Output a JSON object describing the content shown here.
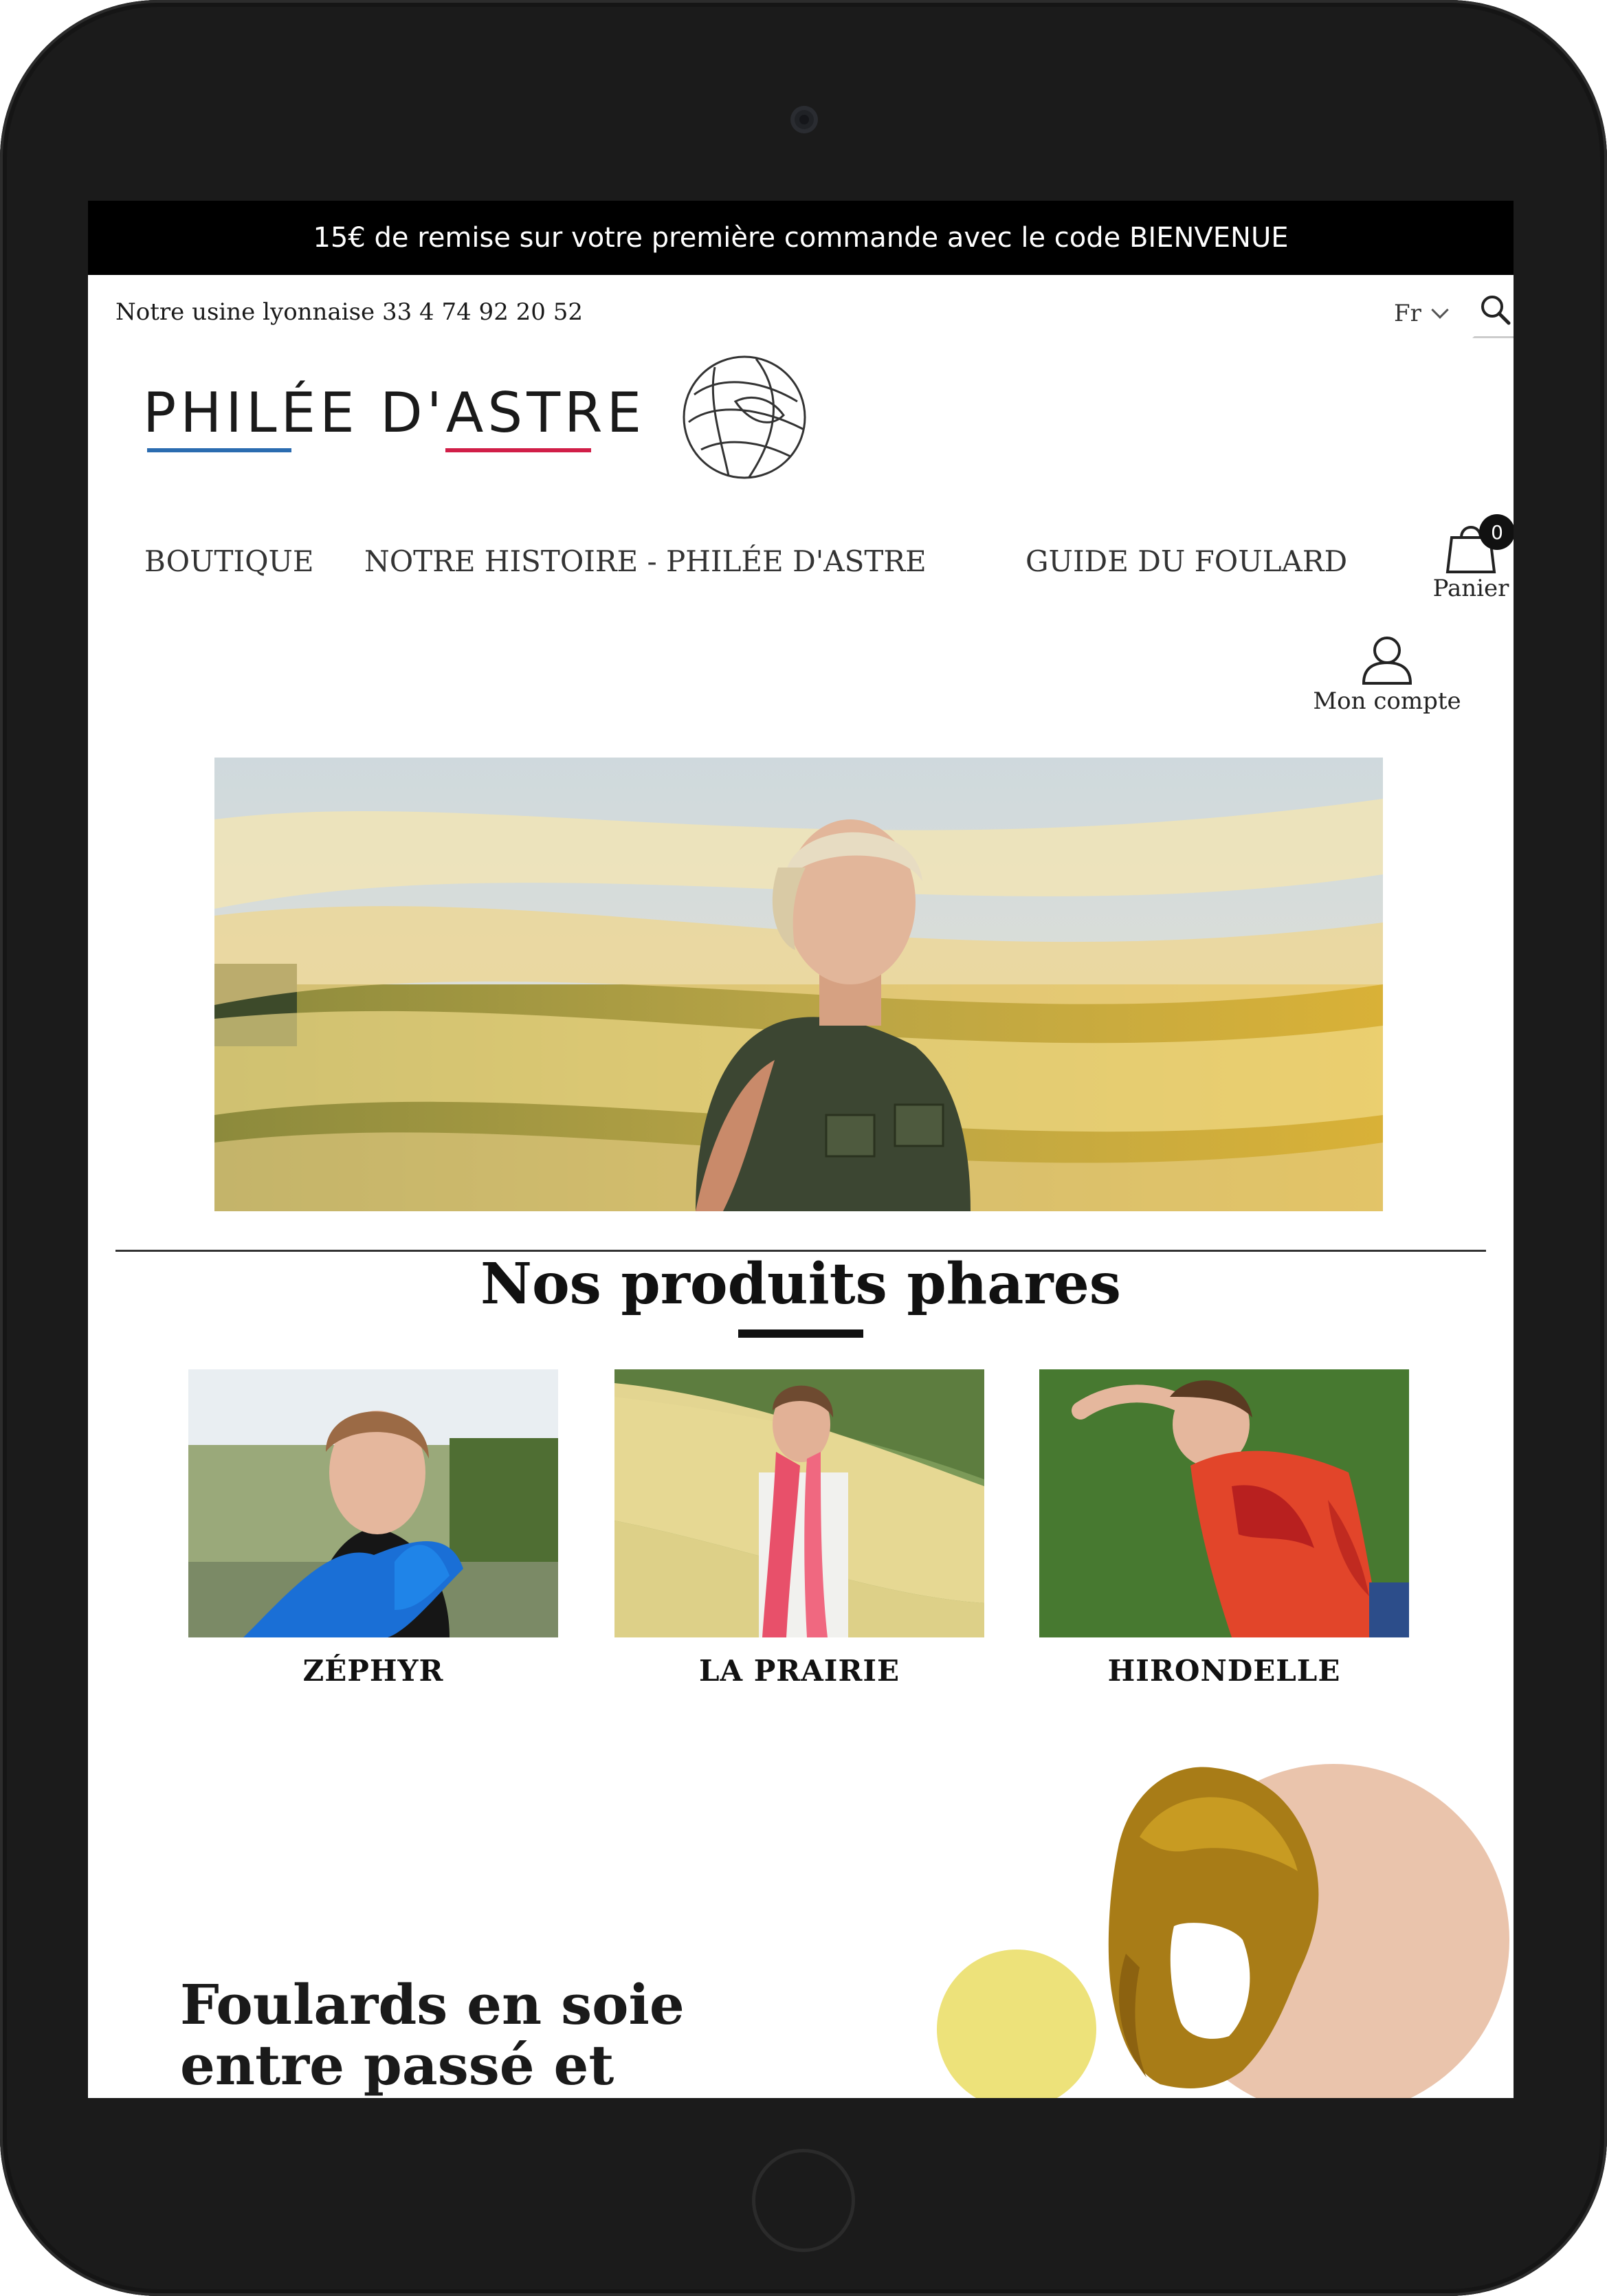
{
  "promo": {
    "text": "15€ de remise sur votre première commande avec le code BIENVENUE"
  },
  "header": {
    "phone": "Notre usine lyonnaise 33 4 74 92 20 52",
    "language": "Fr",
    "logo_text": "PHILÉE D'ASTRE"
  },
  "nav": {
    "items": [
      {
        "label": "BOUTIQUE"
      },
      {
        "label": "NOTRE HISTOIRE - PHILÉE D'ASTRE"
      },
      {
        "label": "GUIDE DU FOULARD"
      }
    ],
    "cart": {
      "label": "Panier",
      "count": "0"
    },
    "account": {
      "label": "Mon compte"
    }
  },
  "featured": {
    "title": "Nos produits phares",
    "products": [
      {
        "name": "ZÉPHYR"
      },
      {
        "name": "LA PRAIRIE"
      },
      {
        "name": "HIRONDELLE"
      }
    ]
  },
  "collection": {
    "headline_line1": "Foulards en soie",
    "headline_line2": "entre passé et"
  },
  "colors": {
    "promo_bg": "#000000",
    "logo_blue": "#2b6cb0",
    "logo_red": "#d11e48",
    "scarf_blue": "#1a6fd6",
    "scarf_pink": "#e8506a",
    "scarf_orange": "#e2452a",
    "hero_gold": "#e8c25a",
    "accent_peach": "#eac4ac",
    "accent_yellow": "#ede27a"
  }
}
